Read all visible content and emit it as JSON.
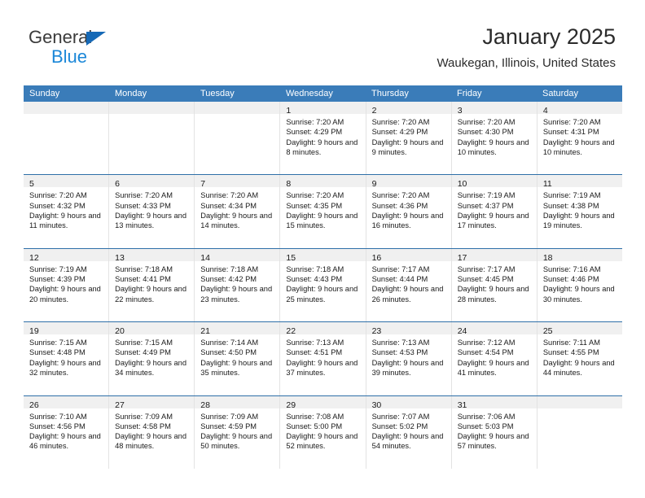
{
  "brand": {
    "name_top": "General",
    "name_bottom": "Blue",
    "accent_color": "#1b87d8",
    "triangle_color": "#1669b6"
  },
  "header": {
    "title": "January 2025",
    "subtitle": "Waukegan, Illinois, United States"
  },
  "calendar": {
    "header_bg": "#3a7cb9",
    "weekdays": [
      "Sunday",
      "Monday",
      "Tuesday",
      "Wednesday",
      "Thursday",
      "Friday",
      "Saturday"
    ],
    "weeks": [
      [
        {
          "day": "",
          "sunrise": "",
          "sunset": "",
          "daylight": ""
        },
        {
          "day": "",
          "sunrise": "",
          "sunset": "",
          "daylight": ""
        },
        {
          "day": "",
          "sunrise": "",
          "sunset": "",
          "daylight": ""
        },
        {
          "day": "1",
          "sunrise": "Sunrise: 7:20 AM",
          "sunset": "Sunset: 4:29 PM",
          "daylight": "Daylight: 9 hours and 8 minutes."
        },
        {
          "day": "2",
          "sunrise": "Sunrise: 7:20 AM",
          "sunset": "Sunset: 4:29 PM",
          "daylight": "Daylight: 9 hours and 9 minutes."
        },
        {
          "day": "3",
          "sunrise": "Sunrise: 7:20 AM",
          "sunset": "Sunset: 4:30 PM",
          "daylight": "Daylight: 9 hours and 10 minutes."
        },
        {
          "day": "4",
          "sunrise": "Sunrise: 7:20 AM",
          "sunset": "Sunset: 4:31 PM",
          "daylight": "Daylight: 9 hours and 10 minutes."
        }
      ],
      [
        {
          "day": "5",
          "sunrise": "Sunrise: 7:20 AM",
          "sunset": "Sunset: 4:32 PM",
          "daylight": "Daylight: 9 hours and 11 minutes."
        },
        {
          "day": "6",
          "sunrise": "Sunrise: 7:20 AM",
          "sunset": "Sunset: 4:33 PM",
          "daylight": "Daylight: 9 hours and 13 minutes."
        },
        {
          "day": "7",
          "sunrise": "Sunrise: 7:20 AM",
          "sunset": "Sunset: 4:34 PM",
          "daylight": "Daylight: 9 hours and 14 minutes."
        },
        {
          "day": "8",
          "sunrise": "Sunrise: 7:20 AM",
          "sunset": "Sunset: 4:35 PM",
          "daylight": "Daylight: 9 hours and 15 minutes."
        },
        {
          "day": "9",
          "sunrise": "Sunrise: 7:20 AM",
          "sunset": "Sunset: 4:36 PM",
          "daylight": "Daylight: 9 hours and 16 minutes."
        },
        {
          "day": "10",
          "sunrise": "Sunrise: 7:19 AM",
          "sunset": "Sunset: 4:37 PM",
          "daylight": "Daylight: 9 hours and 17 minutes."
        },
        {
          "day": "11",
          "sunrise": "Sunrise: 7:19 AM",
          "sunset": "Sunset: 4:38 PM",
          "daylight": "Daylight: 9 hours and 19 minutes."
        }
      ],
      [
        {
          "day": "12",
          "sunrise": "Sunrise: 7:19 AM",
          "sunset": "Sunset: 4:39 PM",
          "daylight": "Daylight: 9 hours and 20 minutes."
        },
        {
          "day": "13",
          "sunrise": "Sunrise: 7:18 AM",
          "sunset": "Sunset: 4:41 PM",
          "daylight": "Daylight: 9 hours and 22 minutes."
        },
        {
          "day": "14",
          "sunrise": "Sunrise: 7:18 AM",
          "sunset": "Sunset: 4:42 PM",
          "daylight": "Daylight: 9 hours and 23 minutes."
        },
        {
          "day": "15",
          "sunrise": "Sunrise: 7:18 AM",
          "sunset": "Sunset: 4:43 PM",
          "daylight": "Daylight: 9 hours and 25 minutes."
        },
        {
          "day": "16",
          "sunrise": "Sunrise: 7:17 AM",
          "sunset": "Sunset: 4:44 PM",
          "daylight": "Daylight: 9 hours and 26 minutes."
        },
        {
          "day": "17",
          "sunrise": "Sunrise: 7:17 AM",
          "sunset": "Sunset: 4:45 PM",
          "daylight": "Daylight: 9 hours and 28 minutes."
        },
        {
          "day": "18",
          "sunrise": "Sunrise: 7:16 AM",
          "sunset": "Sunset: 4:46 PM",
          "daylight": "Daylight: 9 hours and 30 minutes."
        }
      ],
      [
        {
          "day": "19",
          "sunrise": "Sunrise: 7:15 AM",
          "sunset": "Sunset: 4:48 PM",
          "daylight": "Daylight: 9 hours and 32 minutes."
        },
        {
          "day": "20",
          "sunrise": "Sunrise: 7:15 AM",
          "sunset": "Sunset: 4:49 PM",
          "daylight": "Daylight: 9 hours and 34 minutes."
        },
        {
          "day": "21",
          "sunrise": "Sunrise: 7:14 AM",
          "sunset": "Sunset: 4:50 PM",
          "daylight": "Daylight: 9 hours and 35 minutes."
        },
        {
          "day": "22",
          "sunrise": "Sunrise: 7:13 AM",
          "sunset": "Sunset: 4:51 PM",
          "daylight": "Daylight: 9 hours and 37 minutes."
        },
        {
          "day": "23",
          "sunrise": "Sunrise: 7:13 AM",
          "sunset": "Sunset: 4:53 PM",
          "daylight": "Daylight: 9 hours and 39 minutes."
        },
        {
          "day": "24",
          "sunrise": "Sunrise: 7:12 AM",
          "sunset": "Sunset: 4:54 PM",
          "daylight": "Daylight: 9 hours and 41 minutes."
        },
        {
          "day": "25",
          "sunrise": "Sunrise: 7:11 AM",
          "sunset": "Sunset: 4:55 PM",
          "daylight": "Daylight: 9 hours and 44 minutes."
        }
      ],
      [
        {
          "day": "26",
          "sunrise": "Sunrise: 7:10 AM",
          "sunset": "Sunset: 4:56 PM",
          "daylight": "Daylight: 9 hours and 46 minutes."
        },
        {
          "day": "27",
          "sunrise": "Sunrise: 7:09 AM",
          "sunset": "Sunset: 4:58 PM",
          "daylight": "Daylight: 9 hours and 48 minutes."
        },
        {
          "day": "28",
          "sunrise": "Sunrise: 7:09 AM",
          "sunset": "Sunset: 4:59 PM",
          "daylight": "Daylight: 9 hours and 50 minutes."
        },
        {
          "day": "29",
          "sunrise": "Sunrise: 7:08 AM",
          "sunset": "Sunset: 5:00 PM",
          "daylight": "Daylight: 9 hours and 52 minutes."
        },
        {
          "day": "30",
          "sunrise": "Sunrise: 7:07 AM",
          "sunset": "Sunset: 5:02 PM",
          "daylight": "Daylight: 9 hours and 54 minutes."
        },
        {
          "day": "31",
          "sunrise": "Sunrise: 7:06 AM",
          "sunset": "Sunset: 5:03 PM",
          "daylight": "Daylight: 9 hours and 57 minutes."
        },
        {
          "day": "",
          "sunrise": "",
          "sunset": "",
          "daylight": ""
        }
      ]
    ]
  }
}
